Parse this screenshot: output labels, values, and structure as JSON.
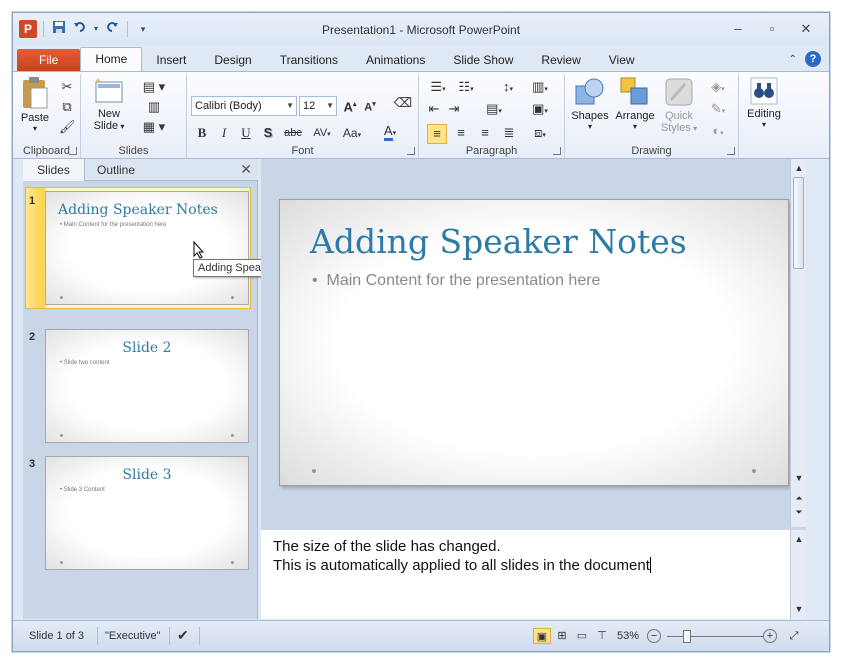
{
  "window": {
    "title": "Presentation1 - Microsoft PowerPoint",
    "app_logo": "P"
  },
  "qat": {
    "icons": [
      "powerpoint-logo-icon",
      "save-icon",
      "undo-icon",
      "redo-icon",
      "customize-icon"
    ]
  },
  "tabs": [
    {
      "label": "File"
    },
    {
      "label": "Home"
    },
    {
      "label": "Insert"
    },
    {
      "label": "Design"
    },
    {
      "label": "Transitions"
    },
    {
      "label": "Animations"
    },
    {
      "label": "Slide Show"
    },
    {
      "label": "Review"
    },
    {
      "label": "View"
    }
  ],
  "ribbon": {
    "clipboard": {
      "label": "Clipboard",
      "paste": "Paste"
    },
    "slides": {
      "label": "Slides",
      "new_slide": "New",
      "new_slide2": "Slide"
    },
    "font": {
      "label": "Font",
      "font_name": "Calibri (Body)",
      "font_size": "12",
      "bold": "B",
      "italic": "I",
      "underline": "U",
      "shadow": "S",
      "strike": "abc",
      "spacing": "AV",
      "case": "Aa",
      "color": "A"
    },
    "paragraph": {
      "label": "Paragraph"
    },
    "drawing": {
      "label": "Drawing",
      "shapes": "Shapes",
      "arrange": "Arrange",
      "quick_styles": "Quick",
      "quick_styles2": "Styles"
    },
    "editing": {
      "label": "Editing"
    }
  },
  "panel": {
    "tab_slides": "Slides",
    "tab_outline": "Outline",
    "slides": [
      {
        "num": "1",
        "title": "Adding Speaker Notes",
        "body": "Main Content for the presentation here"
      },
      {
        "num": "2",
        "title": "Slide 2",
        "body": "Slide two content"
      },
      {
        "num": "3",
        "title": "Slide 3",
        "body": "Slide 3 Content"
      }
    ],
    "tooltip": "Adding Speaker Notes"
  },
  "slide": {
    "title": "Adding Speaker Notes",
    "body": "Main Content for the presentation here"
  },
  "notes": {
    "line1": "The size of the slide has changed.",
    "line2": "This is automatically applied to all slides in the document"
  },
  "status": {
    "slide_info": "Slide 1 of 3",
    "theme": "\"Executive\"",
    "zoom": "53%"
  },
  "colors": {
    "accent": "#2d7aa5",
    "file_tab": "#d24726",
    "selection": "#ffd24a"
  }
}
